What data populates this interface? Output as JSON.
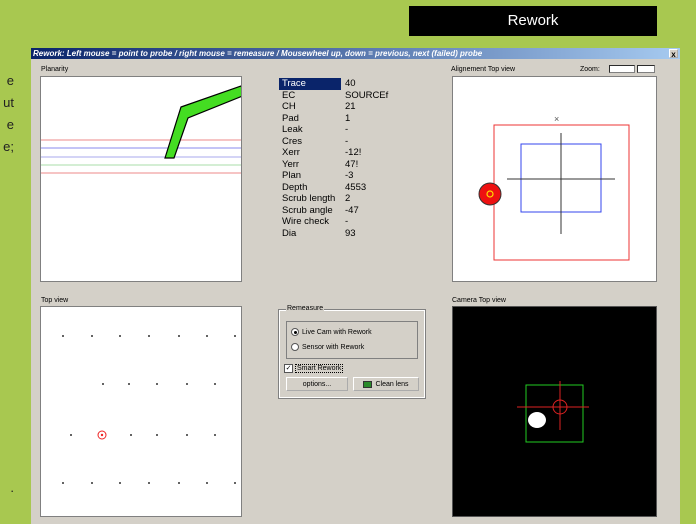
{
  "banner": {
    "title": "Rework"
  },
  "side_text": [
    "e",
    "ut",
    "e",
    "e;",
    "."
  ],
  "window": {
    "title": "Rework: Left mouse = point to probe  /  right mouse = remeasure  /  Mousewheel up, down = previous, next (failed) probe",
    "close_label": "x"
  },
  "panels": {
    "planarity": "Planarity",
    "alignment": "Alignement Top view",
    "top_view": "Top view",
    "camera": "Camera Top view",
    "zoom_label": "Zoom:"
  },
  "properties": [
    {
      "key": "Trace",
      "value": "40",
      "selected": true
    },
    {
      "key": "EC",
      "value": "SOURCEf"
    },
    {
      "key": "CH",
      "value": "21"
    },
    {
      "key": "Pad",
      "value": "1"
    },
    {
      "key": "Leak",
      "value": "-"
    },
    {
      "key": "Cres",
      "value": "-"
    },
    {
      "key": "Xerr",
      "value": "-12!"
    },
    {
      "key": "Yerr",
      "value": "47!"
    },
    {
      "key": "Plan",
      "value": "-3"
    },
    {
      "key": "Depth",
      "value": "4553"
    },
    {
      "key": "Scrub length",
      "value": "2"
    },
    {
      "key": "Scrub angle",
      "value": "-47"
    },
    {
      "key": "Wire check",
      "value": "-"
    },
    {
      "key": "Dia",
      "value": "93"
    }
  ],
  "remeasure": {
    "legend": "Remeasure",
    "option1": "Live Cam with Rework",
    "option2": "Sensor with Rework",
    "selected_option": "Live Cam with Rework",
    "smart_rework_label": "Smart Rework",
    "smart_rework_checked": true,
    "options_button": "options...",
    "clean_lens_button": "Clean lens"
  },
  "colors": {
    "background": "#a8c850",
    "probe_green": "#44dd22",
    "marker_red": "#ee2222",
    "alignment_blue": "#3344ee",
    "title_blue": "#0a246a"
  }
}
